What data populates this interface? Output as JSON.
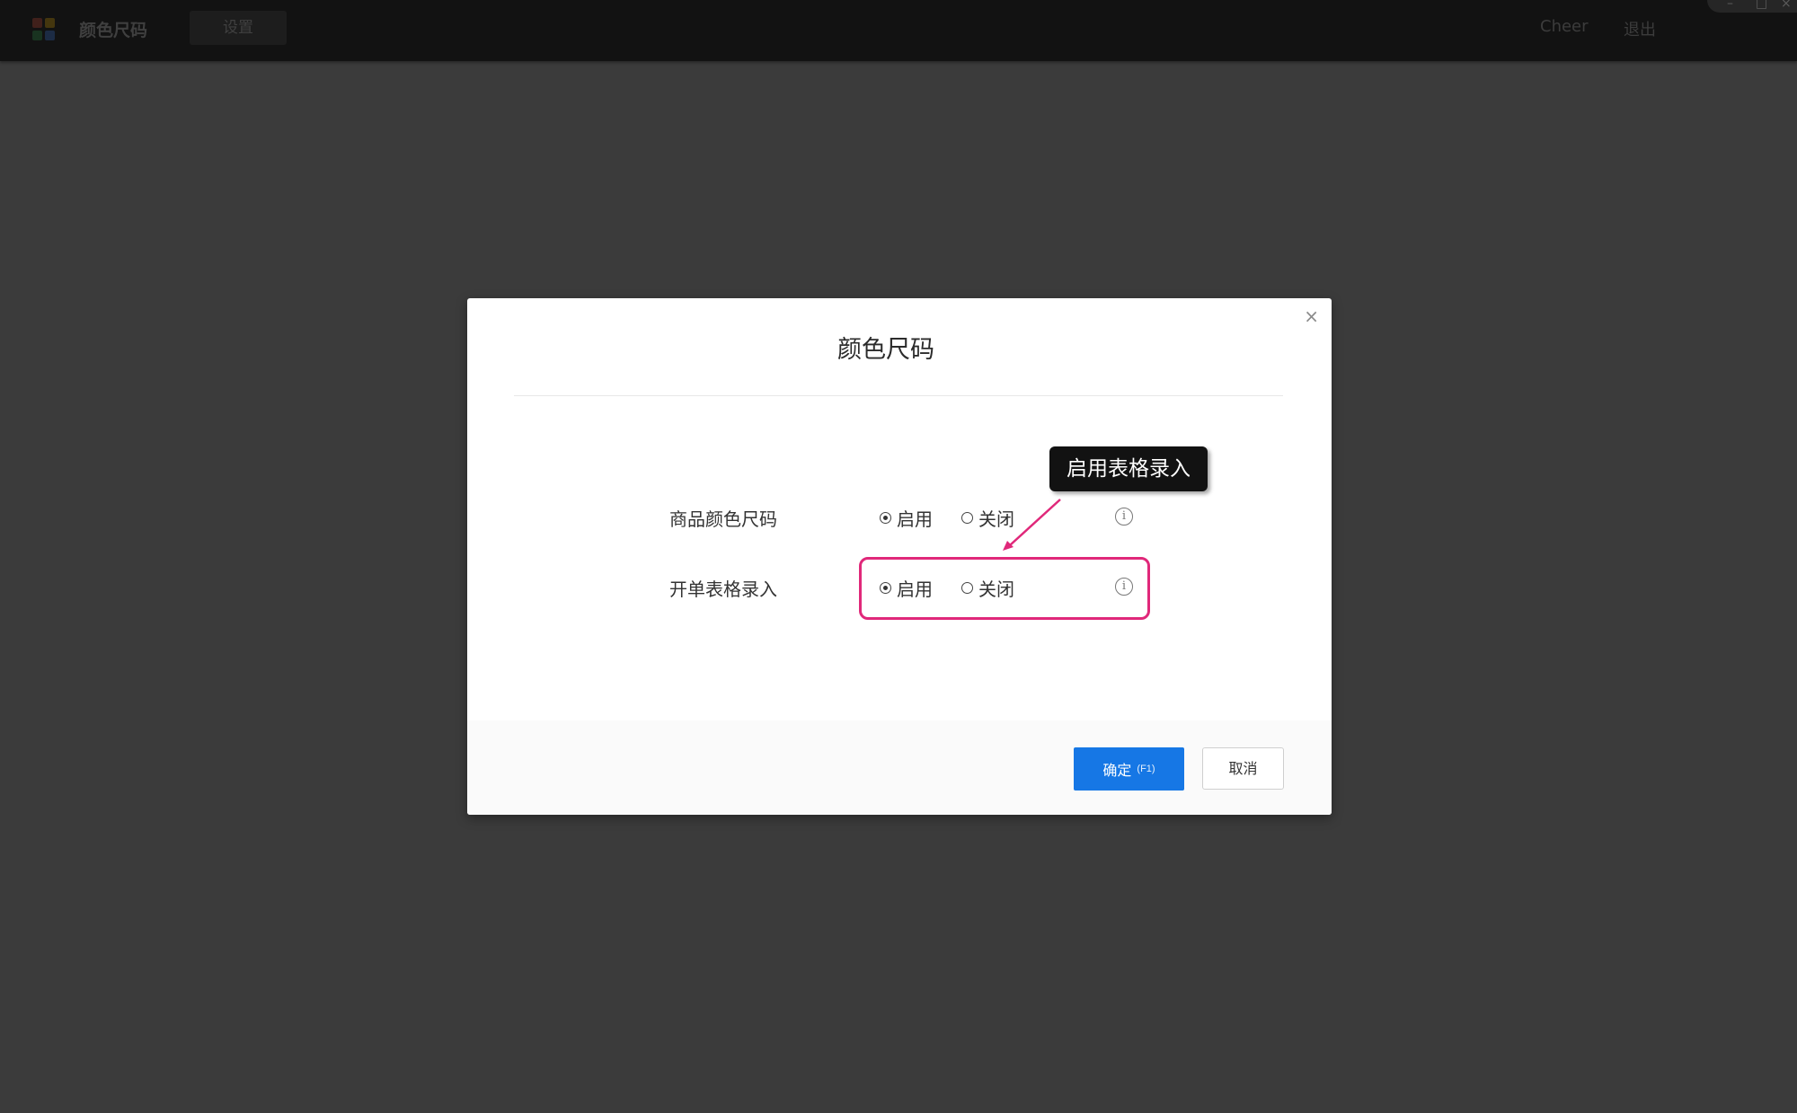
{
  "app": {
    "title": "颜色尺码",
    "tab": "设置",
    "user": "Cheer",
    "logout": "退出",
    "window_controls": {
      "minimize": "–",
      "maximize": "□",
      "close": "×"
    },
    "logo_colors": [
      "#e5533d",
      "#f4b400",
      "#34a853",
      "#4285f4"
    ]
  },
  "modal": {
    "close_icon": "×",
    "title": "颜色尺码",
    "rows": [
      {
        "label": "商品颜色尺码",
        "enable_label": "启用",
        "disable_label": "关闭",
        "selected": "enable",
        "info_icon": "i"
      },
      {
        "label": "开单表格录入",
        "enable_label": "启用",
        "disable_label": "关闭",
        "selected": "enable",
        "info_icon": "i"
      }
    ],
    "tooltip": "启用表格录入",
    "ok_button": {
      "label": "确定",
      "shortcut": "(F1)"
    },
    "cancel_button": {
      "label": "取消"
    }
  },
  "colors": {
    "primary": "#1677e5",
    "highlight": "#e0287a",
    "overlay": "#3b3b3b",
    "tooltip_bg": "#121212"
  }
}
